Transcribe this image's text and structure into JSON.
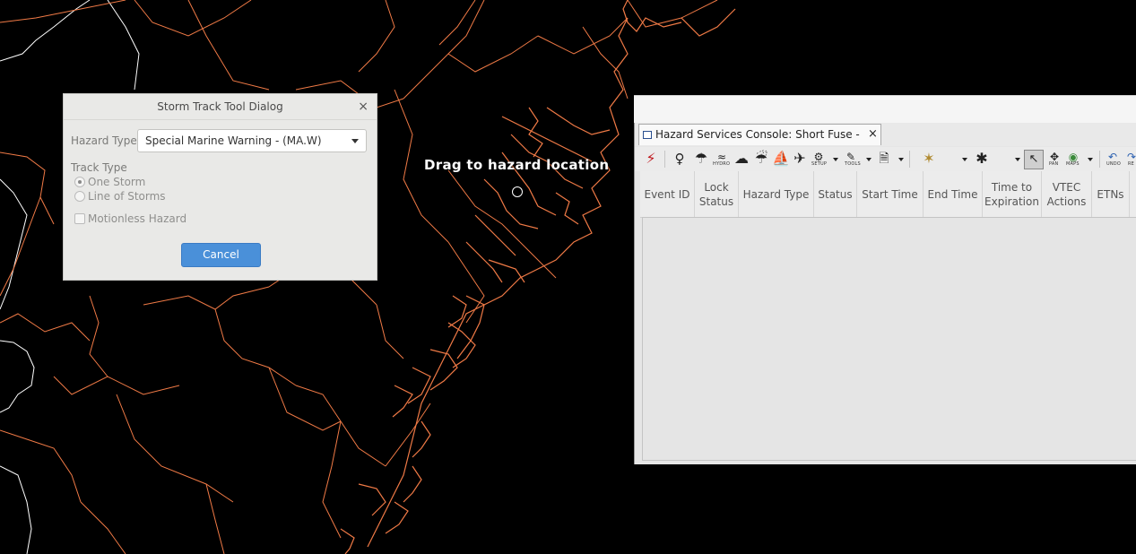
{
  "map": {
    "drag_hint": "Drag to hazard location"
  },
  "storm_dialog": {
    "title": "Storm Track Tool Dialog",
    "close_glyph": "×",
    "hazard_type_label": "Hazard Type",
    "hazard_type_value": "Special Marine Warning - (MA.W)",
    "track_type_label": "Track Type",
    "options": [
      {
        "label": "One Storm",
        "checked": true
      },
      {
        "label": "Line of Storms",
        "checked": false
      }
    ],
    "motionless_label": "Motionless Hazard",
    "motionless_checked": false,
    "cancel_label": "Cancel",
    "cancel_color": "#4a90d9"
  },
  "console": {
    "tab_title": "Hazard Services Console: Short Fuse - CHS",
    "tab_close": "×",
    "toolbar": {
      "hydro_label": "HYDRO",
      "setup_label": "SETUP",
      "tools_label": "TOOLS",
      "pan_label": "PAN",
      "maps_label": "MAPS",
      "undo_label": "UNDO",
      "redo_label": "RE"
    },
    "columns": [
      "Event ID",
      "Lock Status",
      "Hazard Type",
      "Status",
      "Start Time",
      "End Time",
      "Time to Expiration",
      "VTEC Actions",
      "ETNs"
    ]
  }
}
